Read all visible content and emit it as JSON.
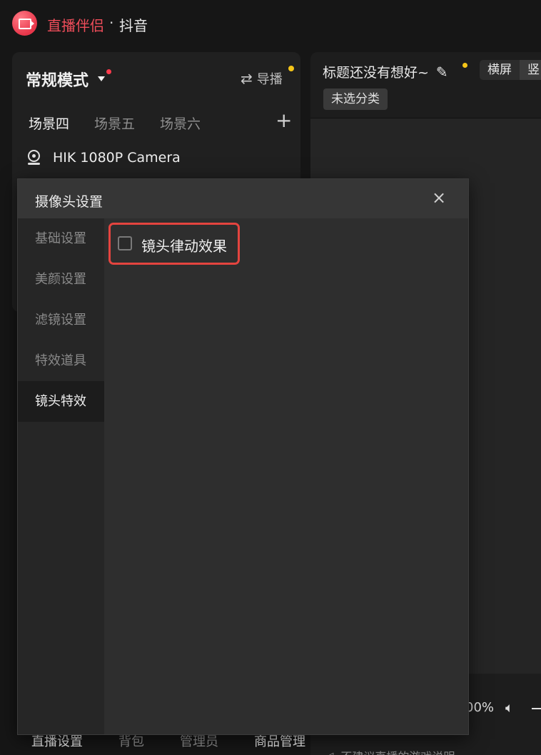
{
  "titlebar": {
    "app_name": "直播伴侣",
    "separator": "·",
    "platform": "抖音"
  },
  "left_panel": {
    "mode_title": "常规模式",
    "guide_label": "导播",
    "scene_tabs": [
      {
        "label": "场景四",
        "active": true
      },
      {
        "label": "场景五",
        "active": false
      },
      {
        "label": "场景六",
        "active": false
      }
    ],
    "add_symbol": "+",
    "camera_name": "HIK 1080P Camera"
  },
  "right_panel": {
    "title_placeholder": "标题还没有想好~",
    "orientation": [
      "横屏",
      "竖"
    ],
    "category": "未选分类",
    "zoom_text": "00%",
    "notice": "不建议直播的游戏说明"
  },
  "bottom_tabs": [
    {
      "label": "直播设置"
    },
    {
      "label": "背包"
    },
    {
      "label": "管理员"
    },
    {
      "label": "商品管理"
    }
  ],
  "modal": {
    "title": "摄像头设置",
    "close_symbol": "×",
    "nav_items": [
      {
        "label": "基础设置",
        "active": false
      },
      {
        "label": "美颜设置",
        "active": false
      },
      {
        "label": "滤镜设置",
        "active": false
      },
      {
        "label": "特效道具",
        "active": false
      },
      {
        "label": "镜头特效",
        "active": true
      }
    ],
    "effect_option": {
      "label": "镜头律动效果",
      "checked": false
    }
  },
  "colors": {
    "brand_red": "#ef4d5a",
    "highlight_border": "#e4443f",
    "notification_yellow": "#f5c518"
  }
}
